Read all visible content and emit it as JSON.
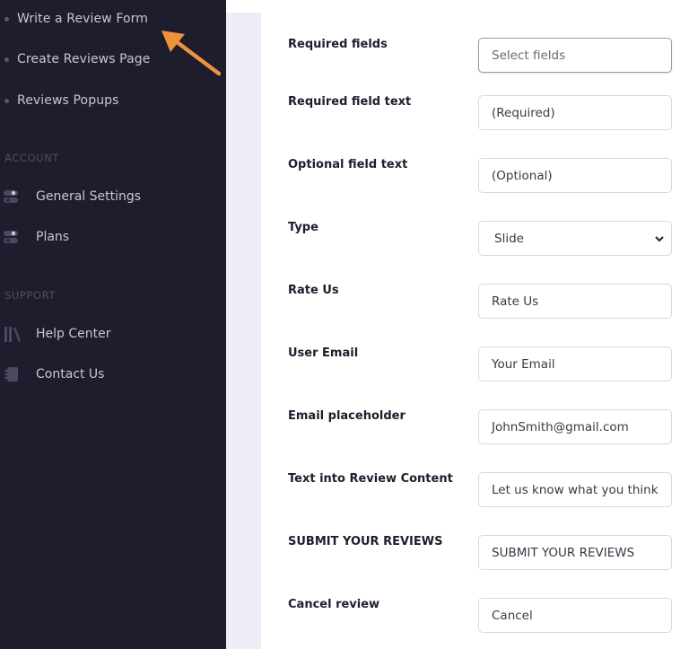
{
  "sidebar": {
    "sub_items": [
      {
        "label": "Write a Review Form"
      },
      {
        "label": "Create Reviews Page"
      },
      {
        "label": "Reviews Popups"
      }
    ],
    "account": {
      "heading": "ACCOUNT",
      "items": [
        {
          "label": "General Settings",
          "icon": "toggle-icon"
        },
        {
          "label": "Plans",
          "icon": "toggle-icon"
        }
      ]
    },
    "support": {
      "heading": "SUPPORT",
      "items": [
        {
          "label": "Help Center",
          "icon": "books-icon"
        },
        {
          "label": "Contact Us",
          "icon": "contact-book-icon"
        }
      ]
    }
  },
  "form": {
    "rows": [
      {
        "label": "Required fields",
        "value": "Select fields"
      },
      {
        "label": "Required field text",
        "value": "(Required)"
      },
      {
        "label": "Optional field text",
        "value": "(Optional)"
      },
      {
        "label": "Type",
        "value": "Slide"
      },
      {
        "label": "Rate Us",
        "value": "Rate Us"
      },
      {
        "label": "User Email",
        "value": "Your Email"
      },
      {
        "label": "Email placeholder",
        "value": "JohnSmith@gmail.com"
      },
      {
        "label": "Text into Review Content",
        "value": "Let us know what you think"
      },
      {
        "label": "SUBMIT YOUR REVIEWS",
        "value": "SUBMIT YOUR REVIEWS"
      },
      {
        "label": "Cancel review",
        "value": "Cancel"
      }
    ]
  },
  "colors": {
    "sidebar_bg": "#1e1d2d",
    "arrow": "#f0923a",
    "gutter": "#ecedf7"
  }
}
